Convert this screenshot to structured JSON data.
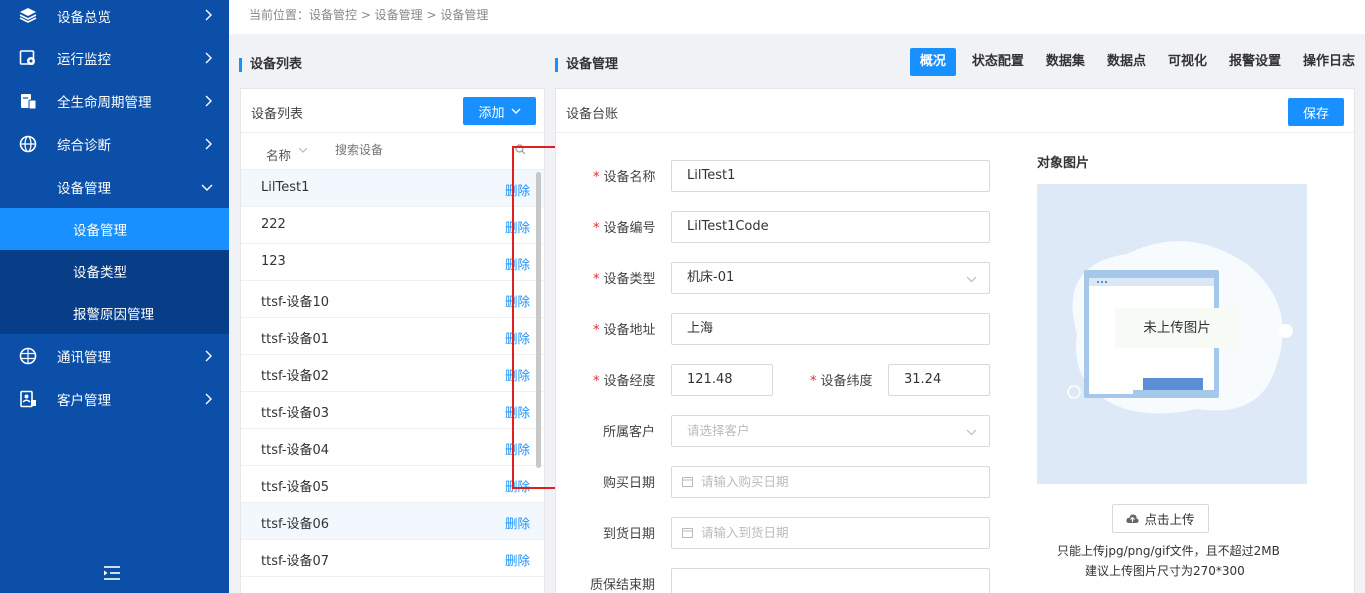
{
  "sidebar": {
    "items": [
      {
        "label": "设备总览"
      },
      {
        "label": "运行监控"
      },
      {
        "label": "全生命周期管理"
      },
      {
        "label": "综合诊断"
      },
      {
        "label": "设备管理"
      },
      {
        "label": "通讯管理"
      },
      {
        "label": "客户管理"
      }
    ],
    "subitems": [
      {
        "label": "设备管理",
        "active": true
      },
      {
        "label": "设备类型"
      },
      {
        "label": "报警原因管理"
      }
    ]
  },
  "breadcrumb": "当前位置：设备管控 > 设备管理 > 设备管理",
  "device_list": {
    "section_title": "设备列表",
    "panel_title": "设备列表",
    "add_label": "添加",
    "name_col": "名称",
    "search_placeholder": "搜索设备",
    "delete_label": "删除",
    "rows": [
      "LilTest1",
      "222",
      "123",
      "ttsf-设备10",
      "ttsf-设备01",
      "ttsf-设备02",
      "ttsf-设备03",
      "ttsf-设备04",
      "ttsf-设备05",
      "ttsf-设备06",
      "ttsf-设备07"
    ]
  },
  "manager": {
    "section_title": "设备管理",
    "tabs": [
      "概况",
      "状态配置",
      "数据集",
      "数据点",
      "可视化",
      "报警设置",
      "操作日志"
    ],
    "active_tab": "概况",
    "panel_title": "设备台账",
    "save_label": "保存"
  },
  "form": {
    "name_label": "设备名称",
    "name_value": "LilTest1",
    "code_label": "设备编号",
    "code_value": "LilTest1Code",
    "type_label": "设备类型",
    "type_value": "机床-01",
    "addr_label": "设备地址",
    "addr_value": "上海",
    "lng_label": "设备经度",
    "lng_value": "121.48",
    "lat_label": "设备纬度",
    "lat_value": "31.24",
    "customer_label": "所属客户",
    "customer_placeholder": "请选择客户",
    "buy_label": "购买日期",
    "buy_placeholder": "请输入购买日期",
    "arrive_label": "到货日期",
    "arrive_placeholder": "请输入到货日期",
    "warranty_label": "质保结束期"
  },
  "image": {
    "title": "对象图片",
    "empty_text": "未上传图片",
    "upload_label": "点击上传",
    "hint1": "只能上传jpg/png/gif文件，且不超过2MB",
    "hint2": "建议上传图片尺寸为270*300"
  },
  "colors": {
    "sidebar": "#0b4fa8",
    "accent": "#1890ff",
    "required": "#f5222d",
    "highlight": "#e02020"
  }
}
